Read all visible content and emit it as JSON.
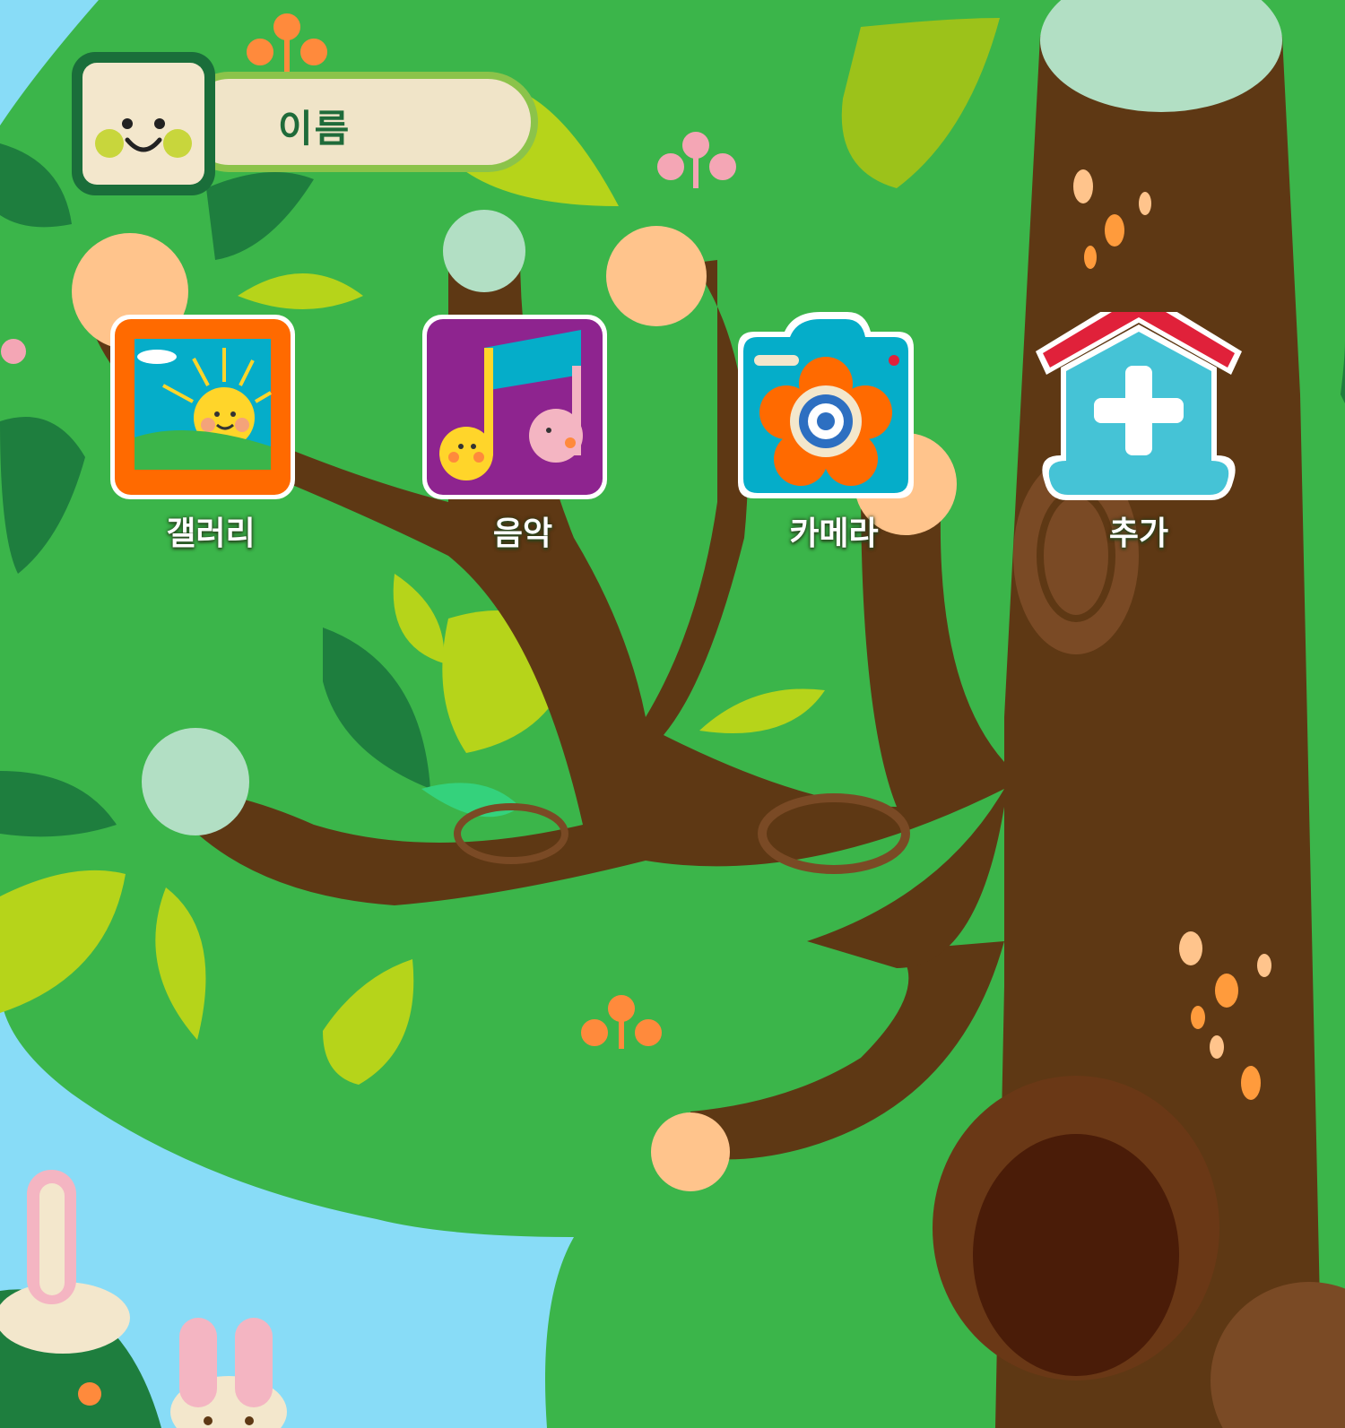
{
  "profile": {
    "name": "이름",
    "avatar": "smiley-face-icon"
  },
  "apps": [
    {
      "label": "갤러리",
      "icon": "gallery-sun-icon"
    },
    {
      "label": "음악",
      "icon": "music-note-icon"
    },
    {
      "label": "카메라",
      "icon": "camera-flower-icon"
    },
    {
      "label": "추가",
      "icon": "add-house-icon"
    }
  ],
  "colors": {
    "sky": "#88dcf7",
    "foliage": "#3bb54a",
    "trunk": "#5e3814",
    "gallery": "#ff6a00",
    "music": "#8e248f",
    "camera": "#05adc9",
    "add_roof": "#e0213a",
    "add_body": "#45c3d6"
  }
}
